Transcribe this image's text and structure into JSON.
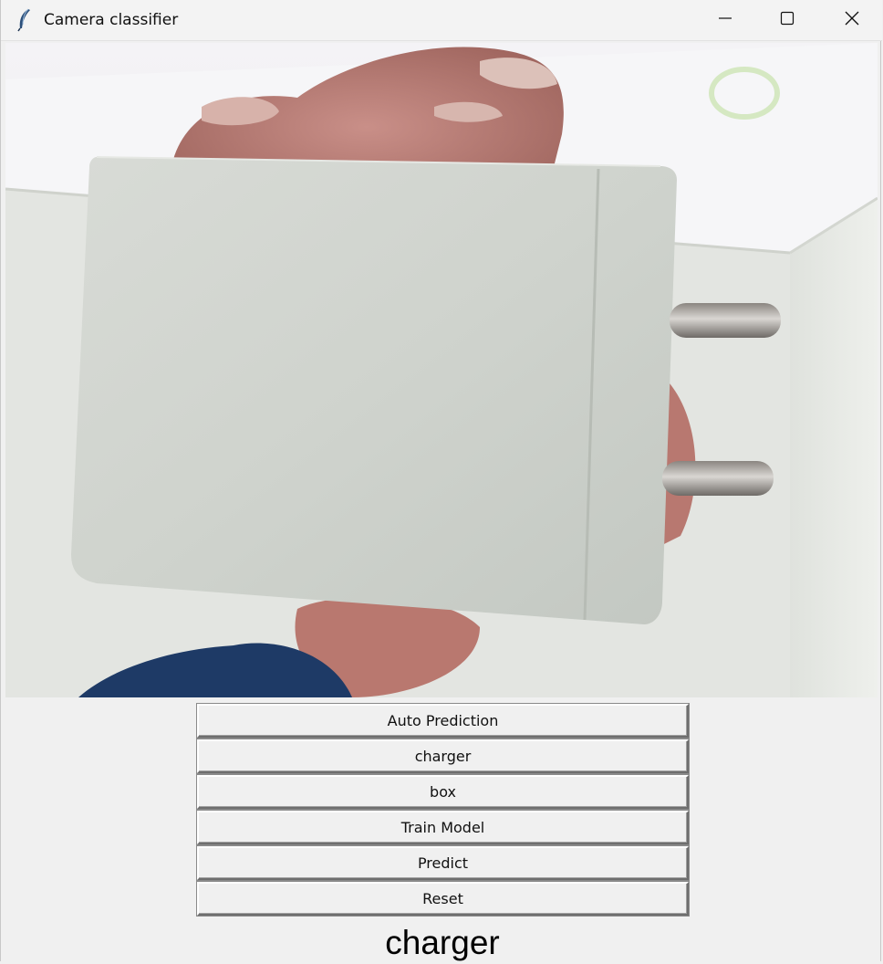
{
  "window": {
    "title": "Camera classifier",
    "icon": "feather-icon",
    "controls": [
      "minimize-icon",
      "maximize-icon",
      "close-icon"
    ]
  },
  "camera": {
    "subject": "wall charger held in hand"
  },
  "buttons": {
    "auto_prediction": "Auto Prediction",
    "class_one": "charger",
    "class_two": "box",
    "train_model": "Train Model",
    "predict": "Predict",
    "reset": "Reset"
  },
  "result": {
    "prediction_label": "charger"
  },
  "colors": {
    "background": "#f0f0f0",
    "titlebar": "#f3f3f3",
    "text": "#111111"
  }
}
